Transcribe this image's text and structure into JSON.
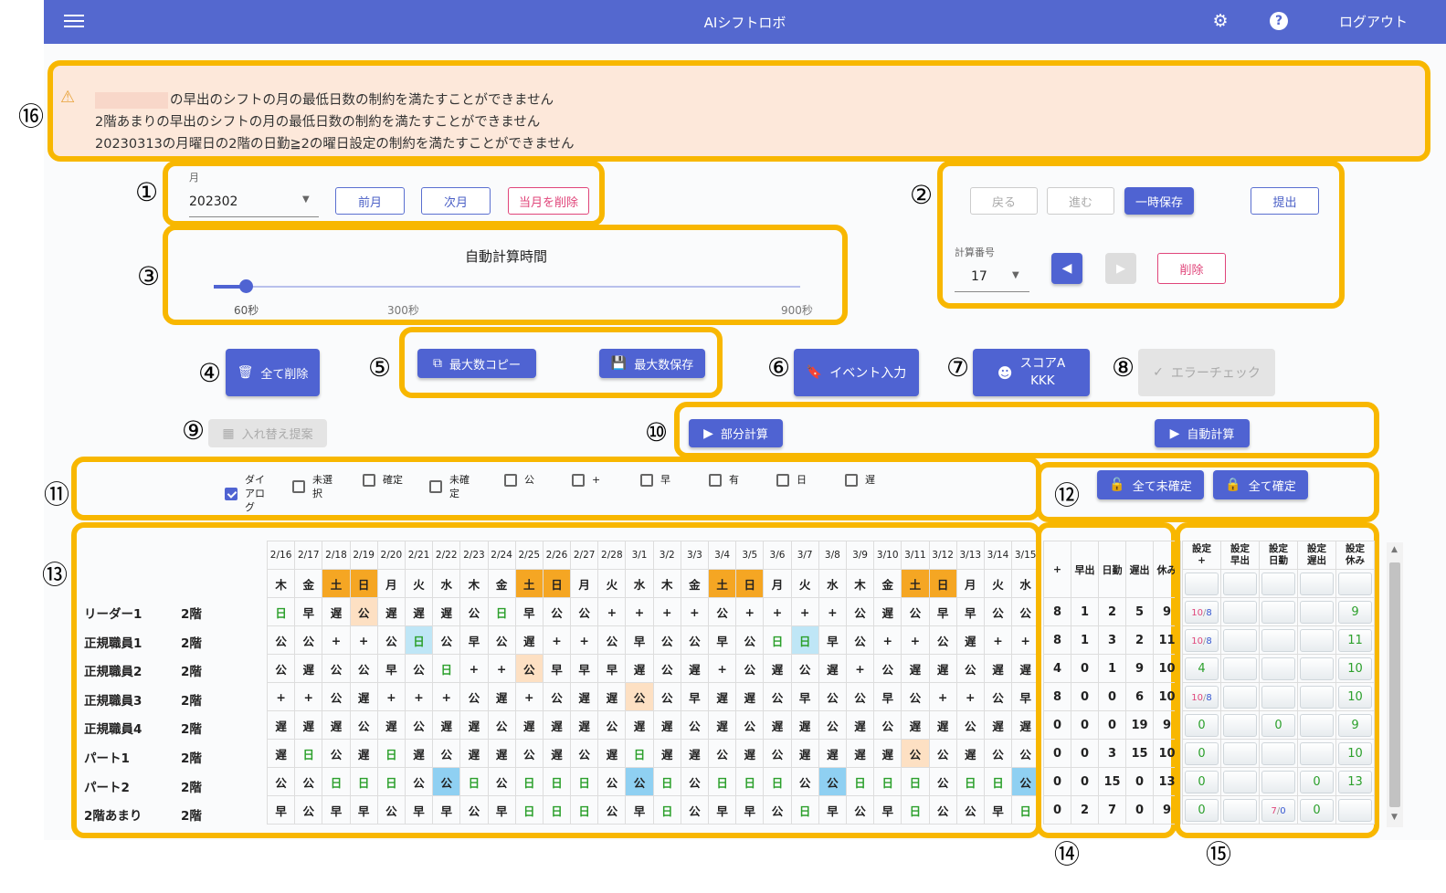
{
  "app": {
    "title": "AIシフトロボ",
    "logout": "ログアウト"
  },
  "callouts": [
    "①",
    "②",
    "③",
    "④",
    "⑤",
    "⑥",
    "⑦",
    "⑧",
    "⑨",
    "⑩",
    "⑪",
    "⑫",
    "⑬",
    "⑭",
    "⑮",
    "⑯"
  ],
  "warnings": [
    "の早出のシフトの月の最低日数の制約を満たすことができません",
    "2階あまりの早出のシフトの月の最低日数の制約を満たすことができません",
    "20230313の月曜日の2階の日勤≧2の曜日設定の制約を満たすことができません"
  ],
  "month": {
    "label": "月",
    "value": "202302",
    "prev": "前月",
    "next": "次月",
    "delete": "当月を削除"
  },
  "history": {
    "back": "戻る",
    "forward": "進む",
    "save": "一時保存",
    "submit": "提出",
    "calc_label": "計算番号",
    "calc_value": "17",
    "delete": "削除"
  },
  "autotime": {
    "title": "自動計算時間",
    "ticks": [
      "60秒",
      "300秒",
      "900秒"
    ],
    "value_seconds": 60
  },
  "actions": {
    "delete_all": "全て削除",
    "copy_max": "最大数コピー",
    "save_max": "最大数保存",
    "event": "イベント入力",
    "score_line1": "スコアA",
    "score_line2": "KKK",
    "error_check": "エラーチェック",
    "swap": "入れ替え提案",
    "partial": "部分計算",
    "auto": "自動計算",
    "all_unconfirm": "全て未確定",
    "all_confirm": "全て確定"
  },
  "filters": [
    {
      "label": "ダイアログ",
      "checked": true
    },
    {
      "label": "未選択",
      "checked": false
    },
    {
      "label": "確定",
      "checked": false
    },
    {
      "label": "未確定",
      "checked": false
    },
    {
      "label": "公",
      "checked": false
    },
    {
      "label": "+",
      "checked": false
    },
    {
      "label": "早",
      "checked": false
    },
    {
      "label": "有",
      "checked": false
    },
    {
      "label": "日",
      "checked": false
    },
    {
      "label": "遅",
      "checked": false
    }
  ],
  "dates": [
    "2/16",
    "2/17",
    "2/18",
    "2/19",
    "2/20",
    "2/21",
    "2/22",
    "2/23",
    "2/24",
    "2/25",
    "2/26",
    "2/27",
    "2/28",
    "3/1",
    "3/2",
    "3/3",
    "3/4",
    "3/5",
    "3/6",
    "3/7",
    "3/8",
    "3/9",
    "3/10",
    "3/11",
    "3/12",
    "3/13",
    "3/14",
    "3/15"
  ],
  "weekdays": [
    "木",
    "金",
    "土",
    "日",
    "月",
    "火",
    "水",
    "木",
    "金",
    "土",
    "日",
    "月",
    "火",
    "水",
    "木",
    "金",
    "土",
    "日",
    "月",
    "火",
    "水",
    "木",
    "金",
    "土",
    "日",
    "月",
    "火",
    "水"
  ],
  "staff": [
    {
      "name": "リーダー1",
      "floor": "2階",
      "shifts": [
        "日",
        "早",
        "遅",
        "公",
        "遅",
        "遅",
        "遅",
        "公",
        "日",
        "早",
        "公",
        "公",
        "+",
        "+",
        "+",
        "+",
        "公",
        "+",
        "+",
        "+",
        "+",
        "公",
        "遅",
        "公",
        "早",
        "早",
        "公",
        "公"
      ],
      "stats": [
        "8",
        "1",
        "2",
        "5",
        "9"
      ],
      "settings": [
        {
          "sup": "10",
          "sub": "8"
        },
        "",
        "",
        "",
        "9"
      ]
    },
    {
      "name": "正規職員1",
      "floor": "2階",
      "shifts": [
        "公",
        "公",
        "+",
        "+",
        "公",
        "日",
        "公",
        "早",
        "公",
        "遅",
        "+",
        "+",
        "公",
        "早",
        "公",
        "公",
        "早",
        "公",
        "日",
        "日",
        "早",
        "公",
        "+",
        "+",
        "公",
        "遅",
        "+",
        "+"
      ],
      "stats": [
        "8",
        "1",
        "3",
        "2",
        "11"
      ],
      "settings": [
        {
          "sup": "10",
          "sub": "8"
        },
        "",
        "",
        "",
        "11"
      ]
    },
    {
      "name": "正規職員2",
      "floor": "2階",
      "shifts": [
        "公",
        "遅",
        "公",
        "公",
        "早",
        "公",
        "日",
        "+",
        "+",
        "公",
        "早",
        "早",
        "早",
        "遅",
        "公",
        "遅",
        "+",
        "公",
        "遅",
        "公",
        "遅",
        "+",
        "公",
        "遅",
        "遅",
        "公",
        "遅",
        "遅"
      ],
      "stats": [
        "4",
        "0",
        "1",
        "9",
        "10"
      ],
      "settings": [
        "4",
        "",
        "",
        "",
        "10"
      ]
    },
    {
      "name": "正規職員3",
      "floor": "2階",
      "shifts": [
        "+",
        "+",
        "公",
        "遅",
        "+",
        "+",
        "+",
        "公",
        "遅",
        "+",
        "公",
        "遅",
        "遅",
        "公",
        "公",
        "早",
        "遅",
        "遅",
        "公",
        "早",
        "公",
        "公",
        "早",
        "公",
        "+",
        "+",
        "公",
        "早"
      ],
      "stats": [
        "8",
        "0",
        "0",
        "6",
        "10"
      ],
      "settings": [
        {
          "sup": "10",
          "sub": "8"
        },
        "",
        "",
        "",
        "10"
      ]
    },
    {
      "name": "正規職員4",
      "floor": "2階",
      "shifts": [
        "遅",
        "遅",
        "遅",
        "公",
        "遅",
        "公",
        "遅",
        "遅",
        "公",
        "遅",
        "遅",
        "遅",
        "公",
        "遅",
        "遅",
        "公",
        "遅",
        "公",
        "遅",
        "遅",
        "公",
        "遅",
        "公",
        "遅",
        "遅",
        "公",
        "遅",
        "遅"
      ],
      "stats": [
        "0",
        "0",
        "0",
        "19",
        "9"
      ],
      "settings": [
        "0",
        "",
        "0",
        "",
        "9"
      ]
    },
    {
      "name": "パート1",
      "floor": "2階",
      "shifts": [
        "遅",
        "日",
        "公",
        "遅",
        "日",
        "遅",
        "公",
        "遅",
        "遅",
        "公",
        "遅",
        "公",
        "遅",
        "日",
        "遅",
        "遅",
        "公",
        "遅",
        "公",
        "遅",
        "遅",
        "遅",
        "遅",
        "公",
        "公",
        "遅",
        "公",
        "公"
      ],
      "stats": [
        "0",
        "0",
        "3",
        "15",
        "10"
      ],
      "settings": [
        "0",
        "",
        "",
        "",
        "10"
      ]
    },
    {
      "name": "パート2",
      "floor": "2階",
      "shifts": [
        "公",
        "公",
        "日",
        "日",
        "日",
        "公",
        "公",
        "日",
        "公",
        "日",
        "日",
        "日",
        "公",
        "公",
        "日",
        "公",
        "日",
        "日",
        "日",
        "公",
        "公",
        "日",
        "日",
        "日",
        "公",
        "日",
        "日",
        "公"
      ],
      "stats": [
        "0",
        "0",
        "15",
        "0",
        "13"
      ],
      "settings": [
        "0",
        "",
        "",
        "0",
        "13"
      ]
    },
    {
      "name": "2階あまり",
      "floor": "2階",
      "shifts": [
        "早",
        "公",
        "早",
        "早",
        "公",
        "早",
        "早",
        "公",
        "早",
        "日",
        "日",
        "日",
        "公",
        "早",
        "日",
        "公",
        "早",
        "早",
        "公",
        "日",
        "早",
        "公",
        "早",
        "日",
        "公",
        "公",
        "早",
        "日"
      ],
      "stats": [
        "0",
        "2",
        "7",
        "0",
        "9"
      ],
      "settings": [
        "0",
        "",
        {
          "sup": "7",
          "sub": "0"
        },
        "0",
        ""
      ]
    }
  ],
  "stats_headers": [
    "+",
    "早出",
    "日勤",
    "遅出",
    "休み"
  ],
  "settings_headers": [
    [
      "設定",
      "+"
    ],
    [
      "設定",
      "早出"
    ],
    [
      "設定",
      "日勤"
    ],
    [
      "設定",
      "遅出"
    ],
    [
      "設定",
      "休み"
    ]
  ],
  "colors": {
    "accent": "#4f63d2",
    "highlight": "#f8b700",
    "warning_bg": "#fde8da",
    "weekend": "#f5a623",
    "green": "#2ca02c"
  }
}
